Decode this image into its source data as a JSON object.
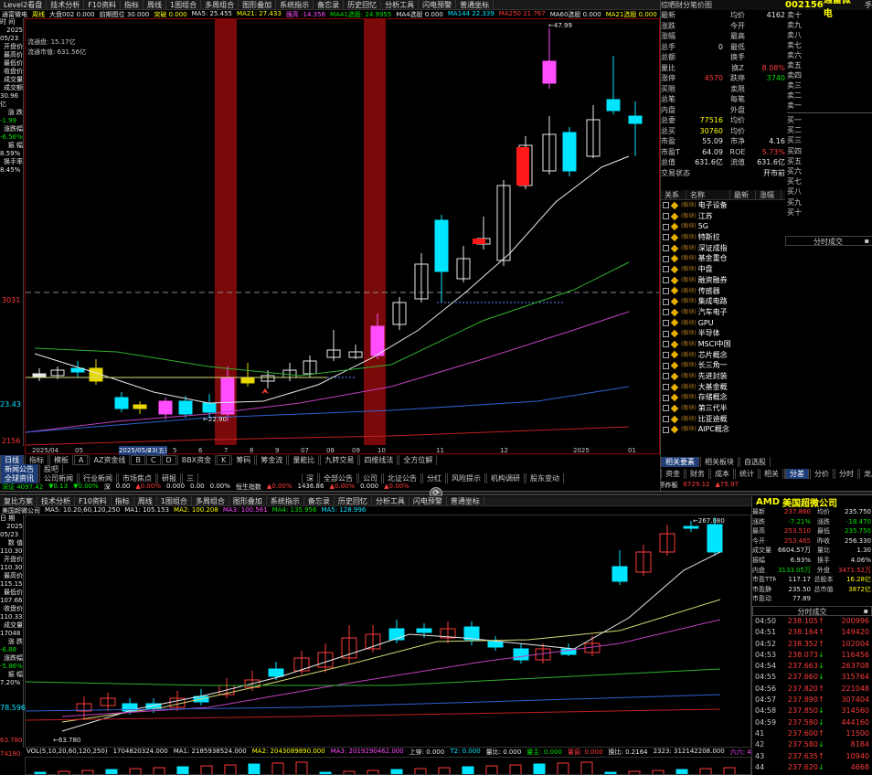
{
  "top": {
    "toolbar": [
      "Level2看盘",
      "技术分析",
      "F10资料",
      "指标",
      "周线",
      "1图组合",
      "多周组合",
      "图形叠加",
      "系统指示",
      "备忘录",
      "历史回忆",
      "分析工具",
      "闪电预警",
      "普通坐标"
    ],
    "title_strip": {
      "name": "通富微电",
      "period": "周线",
      "indicators": [
        {
          "text": "大盘002 0.000",
          "color": "#e8e8e8"
        },
        {
          "text": "前期图位 30.000",
          "color": "#e8e8e8"
        },
        {
          "text": "突破 0.000",
          "color": "#ffff00"
        },
        {
          "text": "MA5: 25.455",
          "color": "#e8e8e8"
        },
        {
          "text": "MA21: 27.433",
          "color": "#ffff00"
        },
        {
          "text": "强高 -14.356",
          "color": "#ff4dff"
        },
        {
          "text": "MA41选股: 24.9955",
          "color": "#00e000"
        },
        {
          "text": "MA4选股 0.000",
          "color": "#e8e8e8"
        },
        {
          "text": "MA144 22.339",
          "color": "#00e5ff"
        },
        {
          "text": "MA250 21.767",
          "color": "#ff3b3b"
        },
        {
          "text": "MA60选股 0.000",
          "color": "#e8e8e8"
        },
        {
          "text": "MA21选股 0.000",
          "color": "#ffff00"
        }
      ]
    },
    "left_panel": [
      {
        "t": "时 间",
        "c": "#e8e8e8"
      },
      {
        "t": "2025",
        "c": "#e8e8e8"
      },
      {
        "t": "05/23",
        "c": "#e8e8e8"
      },
      {
        "t": "开盘价",
        "c": "#e8e8e8"
      },
      {
        "t": "",
        "c": "#e8e8e8"
      },
      {
        "t": "最高价",
        "c": "#e8e8e8"
      },
      {
        "t": "",
        "c": "#e8e8e8"
      },
      {
        "t": "最低价",
        "c": "#e8e8e8"
      },
      {
        "t": "",
        "c": "#e8e8e8"
      },
      {
        "t": "收盘价",
        "c": "#e8e8e8"
      },
      {
        "t": "",
        "c": "#e8e8e8"
      },
      {
        "t": "成交量",
        "c": "#e8e8e8"
      },
      {
        "t": "",
        "c": "#e8e8e8"
      },
      {
        "t": "成交额",
        "c": "#e8e8e8"
      },
      {
        "t": "30.96亿",
        "c": "#e8e8e8"
      },
      {
        "t": "涨 跌",
        "c": "#e8e8e8"
      },
      {
        "t": "-1.99",
        "c": "#00e000"
      },
      {
        "t": "涨跌幅",
        "c": "#e8e8e8"
      },
      {
        "t": "-6.56%",
        "c": "#00e000"
      },
      {
        "t": "振 幅",
        "c": "#e8e8e8"
      },
      {
        "t": "8.59%",
        "c": "#e8e8e8"
      },
      {
        "t": "换手率",
        "c": "#e8e8e8"
      },
      {
        "t": "8.45%",
        "c": "#e8e8e8"
      }
    ],
    "float_info": [
      "流通盘: 15.17亿",
      "流通市值: 631.56亿"
    ],
    "price_labels": {
      "mid": "3031",
      "low": "23.43",
      "bottom": "2156"
    },
    "x_labels": [
      "2025/04",
      "05",
      "2025/05/23(五)",
      "4",
      "5",
      "6",
      "7",
      "8",
      "9",
      "07",
      "08",
      "09",
      "10",
      "11",
      "12",
      "2025",
      "01"
    ],
    "bar_labels": [
      {
        "text": "47.99",
        "kind": "high"
      },
      {
        "text": "22.90",
        "kind": "low"
      }
    ],
    "bottom_tabs": [
      "日线",
      "指标",
      "模板",
      "A",
      "AZ资金线",
      "B",
      "C",
      "D",
      "BBX资金",
      "K",
      "筹码",
      "筹金流",
      "量能比",
      "九转交易",
      "四维线法",
      "全方位解"
    ],
    "news_tabs": [
      "新闻公告",
      "股吧"
    ],
    "news_headers": [
      "全球资讯",
      "公司新闻",
      "行业新闻",
      "市场焦点",
      "研报",
      "三"
    ],
    "bottom_quote_strip": [
      {
        "text": "深证 4097.42",
        "color": "#00e000"
      },
      {
        "text": "▼0.13",
        "color": "#00e000"
      },
      {
        "text": "▼0.00%",
        "color": "#00e000"
      },
      {
        "text": "深",
        "color": "#e8e8e8"
      },
      {
        "text": "0.00",
        "color": "#e8e8e8"
      },
      {
        "text": "▲0.00%",
        "color": "#ff3b3b"
      },
      {
        "text": "0.000",
        "color": "#e8e8e8"
      },
      {
        "text": "0.00",
        "color": "#e8e8e8"
      },
      {
        "text": "0.00%",
        "color": "#e8e8e8"
      },
      {
        "text": "恒生指数",
        "color": "#e8e8e8"
      },
      {
        "text": "▲0.00%",
        "color": "#ff3b3b"
      },
      {
        "text": "1436.86",
        "color": "#e8e8e8"
      },
      {
        "text": "▲0.00%",
        "color": "#ff3b3b"
      },
      {
        "text": "0.000",
        "color": "#e8e8e8"
      },
      {
        "text": "▲0.00%",
        "color": "#ff3b3b"
      }
    ],
    "mid_tabs": [
      "深",
      "全部公告",
      "公司",
      "北证公告",
      "分红",
      "风险提示",
      "机构调研",
      "股东变动"
    ],
    "quote": {
      "tabs": [
        "综",
        "晒",
        "财",
        "分",
        "笔",
        "价",
        "图"
      ],
      "code": "002156",
      "name": "通富微电",
      "shou": "手",
      "rows": [
        {
          "l": "最新",
          "v": "",
          "l2": "均价",
          "v2": "4162"
        },
        {
          "l": "涨跌",
          "v": "",
          "l2": "今开",
          "v2": ""
        },
        {
          "l": "涨幅",
          "v": "",
          "l2": "最高",
          "v2": ""
        },
        {
          "l": "总手",
          "v": "0",
          "l2": "最低",
          "v2": ""
        },
        {
          "l": "总额",
          "v": "",
          "l2": "换手",
          "v2": ""
        },
        {
          "l": "量比",
          "v": "",
          "l2": "换Z",
          "v2": "8.08%"
        },
        {
          "l": "涨停",
          "v": "4570",
          "l2": "跌停",
          "v2": "3740"
        },
        {
          "l": "买限",
          "v": "",
          "l2": "卖限",
          "v2": ""
        },
        {
          "l": "总笔",
          "v": "",
          "l2": "每笔",
          "v2": ""
        },
        {
          "l": "内盘",
          "v": "",
          "l2": "外盘",
          "v2": ""
        },
        {
          "l": "总委",
          "v": "77516",
          "l2": "均价",
          "v2": ""
        },
        {
          "l": "总买",
          "v": "30760",
          "l2": "均价",
          "v2": ""
        },
        {
          "l": "市盈",
          "v": "55.09",
          "l2": "市净",
          "v2": "4.16"
        },
        {
          "l": "市盈T",
          "v": "64.09",
          "l2": "ROE",
          "v2": "5.73%"
        },
        {
          "l": "总值",
          "v": "631.6亿",
          "l2": "流值",
          "v2": "631.6亿"
        },
        {
          "l": "交易状态",
          "v": "",
          "l2": "",
          "v2": "开市前"
        }
      ],
      "sell_levels": [
        "卖十",
        "卖九",
        "卖八",
        "卖七",
        "卖六",
        "卖五",
        "卖四",
        "卖三",
        "卖二",
        "卖一"
      ],
      "buy_levels": [
        "买一",
        "买二",
        "买三",
        "买四",
        "买五",
        "买六",
        "买七",
        "买八",
        "买九",
        "买十"
      ],
      "concept_headers": [
        "关系",
        "名称",
        "最新",
        "涨幅"
      ],
      "concepts": [
        "电子设备",
        "江苏",
        "5G",
        "特斯拉",
        "深证成指",
        "基金重仓",
        "中盘",
        "融资融券",
        "传感器",
        "集成电路",
        "汽车电子",
        "GPU",
        "半导体",
        "MSCI中国",
        "芯片概念",
        "长三角一",
        "先进封装",
        "大基金概",
        "存储概念",
        "第三代半",
        "比亚迪概",
        "AIPC概念"
      ],
      "concept_tag": "(板块)",
      "concept_bottom_tabs": [
        "相关要素",
        "相关板块",
        "自选股"
      ],
      "right_bottom_tabs": [
        "分差",
        "分价",
        "分时",
        "龙虎",
        "资讯"
      ],
      "bottom_tabs2": [
        "资金",
        "财务",
        "成本",
        "统计",
        "相关",
        "场道",
        "基本",
        "分析"
      ],
      "fen_shi": "分时成交",
      "bottom_values": [
        {
          "text": "总成交",
          "color": "#e8e8e8"
        },
        {
          "text": "20.761亿",
          "color": "#ff3b3b"
        },
        {
          "text": "▼2847",
          "color": "#00e000"
        },
        {
          "text": "共2422",
          "color": "#e8e8e8"
        },
        {
          "text": "起始涨停炸板",
          "color": "#e8e8e8"
        },
        {
          "text": "6729.12",
          "color": "#ff3b3b"
        },
        {
          "text": "▲75.97",
          "color": "#ff3b3b"
        }
      ]
    }
  },
  "bottom": {
    "toolbar": [
      "复比方案",
      "技术分析",
      "F10资料",
      "指标",
      "周线",
      "1图组合",
      "多周组合",
      "图形叠加",
      "系统指示",
      "备忘录",
      "历史回忆",
      "分析工具",
      "闪电预警",
      "普通坐标"
    ],
    "title_strip": {
      "name": "美国超微公司",
      "indicators": [
        {
          "text": "MA5: 10.20,60,120,250",
          "color": "#e8e8e8"
        },
        {
          "text": "MA1: 105.153",
          "color": "#e8e8e8"
        },
        {
          "text": "MA2: 100.208",
          "color": "#ffff00"
        },
        {
          "text": "MA3: 100.561",
          "color": "#ff4dff"
        },
        {
          "text": "MA4: 135.956",
          "color": "#00e000"
        },
        {
          "text": "MA5: 128.996",
          "color": "#00e5ff"
        }
      ]
    },
    "left_panel": [
      {
        "t": "日 期",
        "c": "#e8e8e8"
      },
      {
        "t": "2025",
        "c": "#e8e8e8"
      },
      {
        "t": "05/23",
        "c": "#e8e8e8"
      },
      {
        "t": "数 值",
        "c": "#e8e8e8"
      },
      {
        "t": "110.30",
        "c": "#e8e8e8"
      },
      {
        "t": "开盘价",
        "c": "#e8e8e8"
      },
      {
        "t": "110.30",
        "c": "#e8e8e8"
      },
      {
        "t": "最高价",
        "c": "#e8e8e8"
      },
      {
        "t": "115.15",
        "c": "#e8e8e8"
      },
      {
        "t": "最低价",
        "c": "#e8e8e8"
      },
      {
        "t": "107.66",
        "c": "#e8e8e8"
      },
      {
        "t": "收盘价",
        "c": "#e8e8e8"
      },
      {
        "t": "110.33",
        "c": "#e8e8e8"
      },
      {
        "t": "成交量",
        "c": "#e8e8e8"
      },
      {
        "t": "17048",
        "c": "#e8e8e8"
      },
      {
        "t": "涨 跌",
        "c": "#e8e8e8"
      },
      {
        "t": "-6.88",
        "c": "#00e000"
      },
      {
        "t": "涨跌幅",
        "c": "#e8e8e8"
      },
      {
        "t": "-5.86%",
        "c": "#00e000"
      },
      {
        "t": "振 幅",
        "c": "#e8e8e8"
      },
      {
        "t": "7.20%",
        "c": "#e8e8e8"
      }
    ],
    "price_labels": {
      "low": "78.596",
      "bottom": "63.780"
    },
    "bar_labels": [
      {
        "text": "267.080",
        "kind": "high"
      },
      {
        "text": "63.780",
        "kind": "low"
      }
    ],
    "vol_strip": [
      {
        "text": "VOL(5,10,20,60,120,250)",
        "color": "#e8e8e8"
      },
      {
        "text": "1704820324.000",
        "color": "#e8e8e8"
      },
      {
        "text": "MA1: 2185938524.000",
        "color": "#e8e8e8"
      },
      {
        "text": "MA2: 2043089890.000",
        "color": "#ffff00"
      },
      {
        "text": "MA3: 2019290462.000",
        "color": "#ff4dff"
      },
      {
        "text": "上穿: 0.000",
        "color": "#e8e8e8"
      },
      {
        "text": "T2: 0.000",
        "color": "#00e5ff"
      },
      {
        "text": "量比: 0.000",
        "color": "#e8e8e8"
      },
      {
        "text": "量主: 0.000",
        "color": "#00e000"
      },
      {
        "text": "量窗: 0.000",
        "color": "#ff3b3b"
      },
      {
        "text": "换比: 0.2164",
        "color": "#e8e8e8"
      },
      {
        "text": "2323: 312142208.000",
        "color": "#e8e8e8"
      },
      {
        "text": "六六: 4202327624.000",
        "color": "#ff4dff"
      }
    ],
    "vol_left": "74190",
    "quote": {
      "code": "AMD",
      "name": "美国超微公司",
      "rows": [
        {
          "l": "最新",
          "v": "237.860",
          "vc": "#ff3b3b",
          "l2": "均价",
          "v2": "235.750",
          "v2c": "#e8e8e8"
        },
        {
          "l": "涨跌",
          "v": "-7.21%",
          "vc": "#00e000",
          "l2": "涨跌",
          "v2": "-18.470",
          "v2c": "#00e000"
        },
        {
          "l": "最高",
          "v": "253.510",
          "vc": "#ff3b3b",
          "l2": "最低",
          "v2": "235.750",
          "v2c": "#00e000"
        },
        {
          "l": "今开",
          "v": "253.465",
          "vc": "#ff3b3b",
          "l2": "昨收",
          "v2": "256.330",
          "v2c": "#e8e8e8"
        },
        {
          "l": "成交量",
          "v": "6604.57万",
          "vc": "#e8e8e8",
          "l2": "量比",
          "v2": "1.30",
          "v2c": "#e8e8e8"
        },
        {
          "l": "振幅",
          "v": "6.93%",
          "vc": "#e8e8e8",
          "l2": "换手",
          "v2": "4.06%",
          "v2c": "#e8e8e8"
        },
        {
          "l": "内盘",
          "v": "3133.05万",
          "vc": "#00e000",
          "l2": "外盘",
          "v2": "3471.52万",
          "v2c": "#ff3b3b"
        },
        {
          "l": "市盈TTM",
          "v": "117.17",
          "vc": "#e8e8e8",
          "l2": "总股本",
          "v2": "16.28亿",
          "v2c": "#ffff00"
        },
        {
          "l": "市盈静",
          "v": "235.50",
          "vc": "#e8e8e8",
          "l2": "总市值",
          "v2": "3872亿",
          "v2c": "#ffff00"
        },
        {
          "l": "市盈动",
          "v": "77.89",
          "vc": "#e8e8e8",
          "l2": "",
          "v2": "",
          "v2c": "#e8e8e8"
        }
      ],
      "fen_shi": "分时成交",
      "ticks": [
        {
          "t": "04:50",
          "p": "238.105",
          "pc": "#ff3b3b",
          "a": "↑",
          "ac": "#ff3b3b",
          "v": "200996",
          "vc": "#ff3b3b"
        },
        {
          "t": "04:51",
          "p": "238.164",
          "pc": "#ff3b3b",
          "a": "↑",
          "ac": "#ff3b3b",
          "v": "149420",
          "vc": "#ff3b3b"
        },
        {
          "t": "04:52",
          "p": "238.352",
          "pc": "#ff3b3b",
          "a": "↑",
          "ac": "#ff3b3b",
          "v": "102004",
          "vc": "#ff3b3b"
        },
        {
          "t": "04:53",
          "p": "238.073",
          "pc": "#ff3b3b",
          "a": "↓",
          "ac": "#00e000",
          "v": "116456",
          "vc": "#ff3b3b"
        },
        {
          "t": "04:54",
          "p": "237.663",
          "pc": "#ff3b3b",
          "a": "↓",
          "ac": "#00e000",
          "v": "263708",
          "vc": "#ff3b3b"
        },
        {
          "t": "04:55",
          "p": "237.660",
          "pc": "#ff3b3b",
          "a": "↓",
          "ac": "#00e000",
          "v": "315764",
          "vc": "#ff3b3b"
        },
        {
          "t": "04:56",
          "p": "237.820",
          "pc": "#ff3b3b",
          "a": "↑",
          "ac": "#ff3b3b",
          "v": "221048",
          "vc": "#ff3b3b"
        },
        {
          "t": "04:57",
          "p": "237.890",
          "pc": "#ff3b3b",
          "a": "↑",
          "ac": "#ff3b3b",
          "v": "307404",
          "vc": "#ff3b3b"
        },
        {
          "t": "04:58",
          "p": "237.850",
          "pc": "#ff3b3b",
          "a": "↓",
          "ac": "#00e000",
          "v": "314560",
          "vc": "#ff3b3b"
        },
        {
          "t": "04:59",
          "p": "237.580",
          "pc": "#ff3b3b",
          "a": "↓",
          "ac": "#00e000",
          "v": "444160",
          "vc": "#ff3b3b"
        },
        {
          "t": "41",
          "p": "237.600",
          "pc": "#ff3b3b",
          "a": "↑",
          "ac": "#ff3b3b",
          "v": "11500",
          "vc": "#ff3b3b"
        },
        {
          "t": "42",
          "p": "237.580",
          "pc": "#ff3b3b",
          "a": "↓",
          "ac": "#00e000",
          "v": "8184",
          "vc": "#ff3b3b"
        },
        {
          "t": "43",
          "p": "237.635",
          "pc": "#ff3b3b",
          "a": "↑",
          "ac": "#ff3b3b",
          "v": "10940",
          "vc": "#ff3b3b"
        },
        {
          "t": "44",
          "p": "237.620",
          "pc": "#ff3b3b",
          "a": "↓",
          "ac": "#00e000",
          "v": "4668",
          "vc": "#ff3b3b"
        },
        {
          "t": "45",
          "p": "237.650",
          "pc": "#ff3b3b",
          "a": "↑",
          "ac": "#ff3b3b",
          "v": "9292",
          "vc": "#ff3b3b"
        },
        {
          "t": "46",
          "p": "237.650",
          "pc": "#ff3b3b",
          "a": "↑",
          "ac": "#ff3b3b",
          "v": "10912",
          "vc": "#ff3b3b"
        }
      ]
    }
  },
  "colors": {
    "up": "#ff3b3b",
    "down": "#00e5ff",
    "ma_white": "#e8e8e8",
    "ma_yellow": "#d8d878",
    "ma_mag": "#c040c0",
    "ma_green": "#30b030",
    "ma_blue": "#3060d0",
    "ma_red": "#c02020",
    "highlight_band": "#7a0a0a"
  }
}
